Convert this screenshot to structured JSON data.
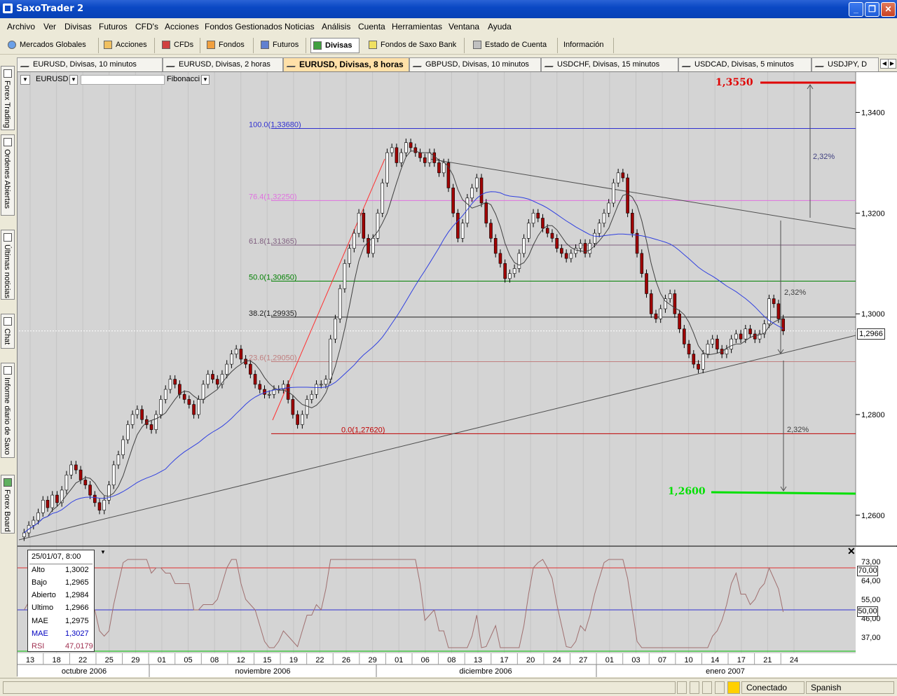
{
  "window": {
    "title": "SaxoTrader 2",
    "minimize": "_",
    "maximize": "❐",
    "close": "✕"
  },
  "menu": [
    "Archivo",
    "Ver",
    "Divisas",
    "Futuros",
    "CFD's",
    "Acciones",
    "Fondos Gestionados",
    "Noticias",
    "Análisis",
    "Cuenta",
    "Herramientas",
    "Ventana",
    "Ayuda"
  ],
  "toolbar": [
    "Mercados Globales",
    "Acciones",
    "CFDs",
    "Fondos",
    "Futuros",
    "Divisas",
    "Fondos de Saxo Bank",
    "Estado de Cuenta",
    "Información"
  ],
  "toolbar_active": "Divisas",
  "tabs": [
    "EURUSD, Divisas, 10 minutos",
    "EURUSD, Divisas, 2 horas",
    "EURUSD, Divisas, 8 horas",
    "GBPUSD, Divisas, 10 minutos",
    "USDCHF, Divisas, 15 minutos",
    "USDCAD, Divisas, 5 minutos",
    "USDJPY, D"
  ],
  "tab_active": "EURUSD, Divisas, 8 horas",
  "sidebar": [
    "Forex Trading",
    "Ordenes Abiertas",
    "Últimas noticias",
    "Chat",
    "Informe diario de Saxo",
    "Forex Board"
  ],
  "chart_header": {
    "symbol": "EURUSD",
    "tool": "Fibonacci"
  },
  "price_axis": [
    "1,3400",
    "1,3200",
    "1,3000",
    "1,2800",
    "1,2600"
  ],
  "current_price": "1,2966",
  "level_labels": {
    "target_high": "1,3550",
    "target_low": "1,2600"
  },
  "fibonacci": [
    {
      "label": "100.0(1,33680)",
      "price": 1.3368,
      "color": "#3030d0"
    },
    {
      "label": "76.4(1,32250)",
      "price": 1.3225,
      "color": "#e070e0"
    },
    {
      "label": "61.8(1,31365)",
      "price": 1.31365,
      "color": "#806080"
    },
    {
      "label": "50.0(1,30650)",
      "price": 1.3065,
      "color": "#008000"
    },
    {
      "label": "38.2(1,29935)",
      "price": 1.29935,
      "color": "#202020"
    },
    {
      "label": "23.6(1,29050)",
      "price": 1.2905,
      "color": "#c08080"
    },
    {
      "label": "0.0(1,27620)",
      "price": 1.2762,
      "color": "#c00000"
    }
  ],
  "percent_labels": [
    "2,32%",
    "2,32%",
    "2,32%"
  ],
  "rsi_axis": [
    "73,00",
    "64,00",
    "55,00",
    "46,00",
    "37,00"
  ],
  "rsi_levels": [
    "70,00",
    "50,00"
  ],
  "date_axis": {
    "days": [
      "13",
      "18",
      "22",
      "25",
      "29",
      "01",
      "05",
      "08",
      "12",
      "15",
      "19",
      "22",
      "26",
      "29",
      "01",
      "06",
      "08",
      "13",
      "17",
      "20",
      "24",
      "27",
      "01",
      "03",
      "07",
      "10",
      "14",
      "17",
      "21",
      "24"
    ],
    "months": [
      "octubre 2006",
      "noviembre 2006",
      "diciembre 2006",
      "enero 2007"
    ]
  },
  "info_panel": {
    "datetime": "25/01/07, 8:00",
    "rows": [
      {
        "label": "Alto",
        "value": "1,3002",
        "color": "#000000"
      },
      {
        "label": "Bajo",
        "value": "1,2965",
        "color": "#000000"
      },
      {
        "label": "Abierto",
        "value": "1,2984",
        "color": "#000000"
      },
      {
        "label": "Ultimo",
        "value": "1,2966",
        "color": "#000000"
      },
      {
        "label": "MAE",
        "value": "1,2975",
        "color": "#000000"
      },
      {
        "label": "MAE",
        "value": "1,3027",
        "color": "#0000c0"
      },
      {
        "label": "RSI",
        "value": "47,0179",
        "color": "#a03050"
      }
    ]
  },
  "status": {
    "connection": "Conectado",
    "language": "Spanish"
  },
  "chart_data": {
    "type": "candlestick",
    "ylim": [
      1.254,
      1.348
    ],
    "close": [
      1.2565,
      1.258,
      1.259,
      1.2605,
      1.263,
      1.2615,
      1.264,
      1.2625,
      1.265,
      1.268,
      1.27,
      1.269,
      1.267,
      1.266,
      1.264,
      1.2625,
      1.261,
      1.263,
      1.266,
      1.27,
      1.272,
      1.275,
      1.278,
      1.28,
      1.281,
      1.279,
      1.278,
      1.277,
      1.28,
      1.283,
      1.285,
      1.287,
      1.286,
      1.284,
      1.283,
      1.282,
      1.28,
      1.283,
      1.286,
      1.288,
      1.287,
      1.286,
      1.288,
      1.29,
      1.292,
      1.293,
      1.291,
      1.29,
      1.288,
      1.286,
      1.285,
      1.284,
      1.284,
      1.285,
      1.285,
      1.286,
      1.283,
      1.28,
      1.278,
      1.28,
      1.283,
      1.284,
      1.286,
      1.286,
      1.287,
      1.295,
      1.299,
      1.305,
      1.31,
      1.313,
      1.316,
      1.32,
      1.315,
      1.312,
      1.315,
      1.32,
      1.326,
      1.332,
      1.333,
      1.33,
      1.332,
      1.334,
      1.333,
      1.332,
      1.331,
      1.33,
      1.332,
      1.33,
      1.328,
      1.33,
      1.325,
      1.32,
      1.315,
      1.318,
      1.323,
      1.325,
      1.327,
      1.322,
      1.318,
      1.315,
      1.312,
      1.31,
      1.307,
      1.308,
      1.309,
      1.312,
      1.315,
      1.318,
      1.32,
      1.319,
      1.317,
      1.316,
      1.315,
      1.313,
      1.312,
      1.311,
      1.312,
      1.313,
      1.314,
      1.312,
      1.314,
      1.316,
      1.318,
      1.32,
      1.322,
      1.326,
      1.328,
      1.327,
      1.32,
      1.316,
      1.312,
      1.308,
      1.304,
      1.3,
      1.299,
      1.301,
      1.303,
      1.304,
      1.3,
      1.297,
      1.294,
      1.292,
      1.29,
      1.289,
      1.292,
      1.294,
      1.295,
      1.293,
      1.292,
      1.293,
      1.295,
      1.296,
      1.295,
      1.297,
      1.296,
      1.295,
      1.296,
      1.298,
      1.303,
      1.302,
      1.299,
      1.2966
    ]
  }
}
